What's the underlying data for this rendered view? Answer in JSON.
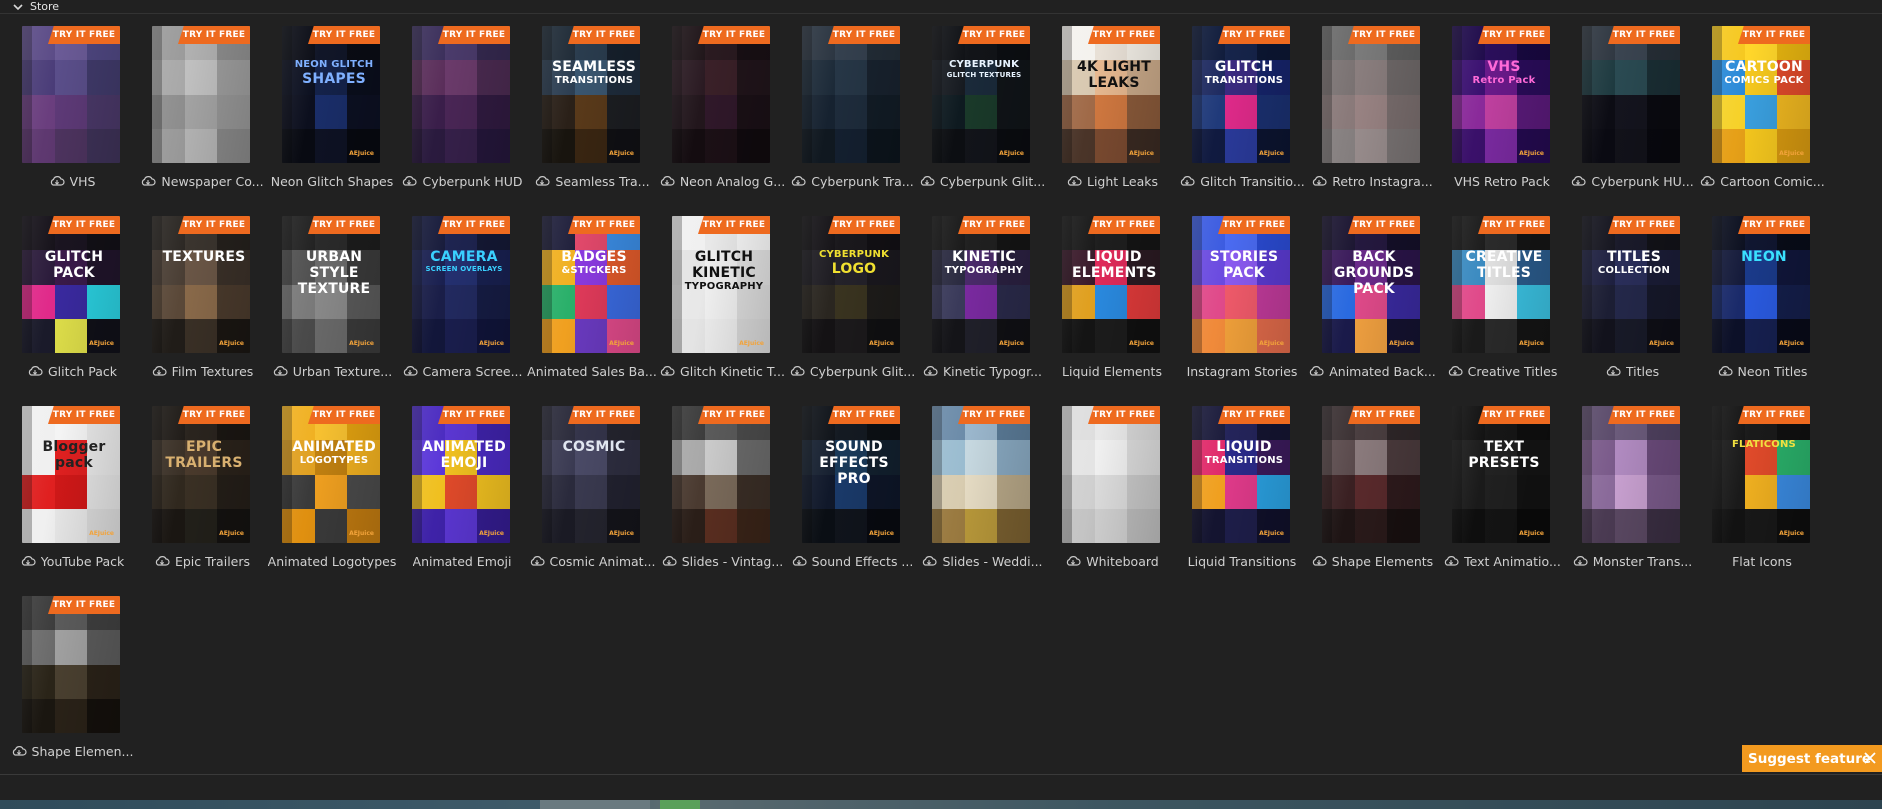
{
  "panel": {
    "title": "Store",
    "chevron_icon": "chevron-down-icon"
  },
  "badge_text": "TRY IT FREE",
  "publisher_mark": "AEJuice",
  "suggest": {
    "label": "Suggest feature",
    "close_icon": "close-icon"
  },
  "items": [
    {
      "label": "VHS",
      "cloud": true,
      "art": [],
      "colors": [
        "#5a4a86",
        "#6a5a96",
        "#4e4680",
        "#4a3c78",
        "#5a4e8a",
        "#403a6a",
        "#6a3e7e",
        "#5e3a78",
        "#4a3868",
        "#5e3870",
        "#4e3460",
        "#3e3258"
      ]
    },
    {
      "label": "Newspaper Co...",
      "cloud": true,
      "art": [],
      "colors": [
        "#9a9a9a",
        "#b0b0b0",
        "#8c8c8c",
        "#a8a8a8",
        "#c0c0c0",
        "#9c9c9c",
        "#8e8e8e",
        "#a4a4a4",
        "#969696",
        "#9a9a9a",
        "#b4b4b4",
        "#888888"
      ]
    },
    {
      "label": "Neon Glitch Shapes",
      "cloud": false,
      "art": [
        "NEON GLITCH",
        "SHAPES"
      ],
      "artColor": "#7fb0ff",
      "colors": [
        "#0b0d16",
        "#111628",
        "#0a0c14",
        "#0c1020",
        "#14224a",
        "#0a0e1c",
        "#0c0f1e",
        "#1a2e6a",
        "#0c1022",
        "#080a12",
        "#0e1224",
        "#070910"
      ]
    },
    {
      "label": "Cyberpunk HUD",
      "cloud": true,
      "art": [],
      "colors": [
        "#3a2e5a",
        "#4a3a6a",
        "#34284e",
        "#5a2e5a",
        "#6a3a6a",
        "#4a2a50",
        "#3a1e4a",
        "#4a2656",
        "#301a40",
        "#2a1a3e",
        "#36204a",
        "#24163a"
      ]
    },
    {
      "label": "Seamless Tra...",
      "cloud": true,
      "art": [
        "SEAMLESS",
        "TRANSITIONS"
      ],
      "artColor": "#ffffff",
      "colors": [
        "#1e2a36",
        "#2a3c4e",
        "#16202c",
        "#2c3e52",
        "#3a5670",
        "#1e2c3c",
        "#2a2018",
        "#5a3a1a",
        "#1c1e22",
        "#18140e",
        "#3a2612",
        "#101014"
      ]
    },
    {
      "label": "Neon Analog G...",
      "cloud": true,
      "art": [],
      "colors": [
        "#1e1418",
        "#2a1a20",
        "#180f14",
        "#2a1a22",
        "#3a2028",
        "#20141a",
        "#22161c",
        "#30182a",
        "#1a1016",
        "#140c10",
        "#1c1016",
        "#100a0e"
      ]
    },
    {
      "label": "Cyberpunk Tra...",
      "cloud": true,
      "art": [],
      "colors": [
        "#2a3440",
        "#34404e",
        "#222c36",
        "#1c2a38",
        "#263646",
        "#18222e",
        "#162230",
        "#1e2c3c",
        "#121c26",
        "#101820",
        "#142030",
        "#0c141c"
      ]
    },
    {
      "label": "Cyberpunk Glit...",
      "cloud": true,
      "art": [
        "CYBERPUNK",
        "GLITCH TEXTURES"
      ],
      "artColor": "#e8f4ff",
      "colors": [
        "#0e1014",
        "#121418",
        "#0c0e12",
        "#161a20",
        "#1a2a3a",
        "#101418",
        "#0e1a20",
        "#1a3a2a",
        "#101418",
        "#0c0e12",
        "#12141a",
        "#0a0c10"
      ]
    },
    {
      "label": "Light Leaks",
      "cloud": true,
      "art": [
        "4K LIGHT",
        "LEAKS"
      ],
      "artColor": "#111111",
      "colors": [
        "#f4f2ee",
        "#e8e0d6",
        "#f0ece4",
        "#d8c8b0",
        "#e6b890",
        "#c8a888",
        "#a06a48",
        "#d07840",
        "#8a5a3a",
        "#4a3428",
        "#7a4a30",
        "#3a2a22"
      ]
    },
    {
      "label": "Glitch Transitio...",
      "cloud": true,
      "art": [
        "GLITCH",
        "TRANSITIONS"
      ],
      "artColor": "#ffffff",
      "colors": [
        "#0e1a3a",
        "#16244a",
        "#0c1632",
        "#1e2a60",
        "#3a2a80",
        "#16246a",
        "#203a7a",
        "#e02a8a",
        "#1a3070",
        "#101a40",
        "#2a3a9a",
        "#0c1430"
      ]
    },
    {
      "label": "Retro Instagra...",
      "cloud": true,
      "art": [],
      "colors": [
        "#6a6a6a",
        "#7a7a7a",
        "#5e5e5e",
        "#7a7272",
        "#8a7e7e",
        "#6e6868",
        "#8a7a7a",
        "#9a8484",
        "#7a6e6e",
        "#868080",
        "#9a8e8e",
        "#7a7474"
      ]
    },
    {
      "label": "VHS Retro Pack",
      "cloud": false,
      "art": [
        "VHS",
        "Retro Pack"
      ],
      "artColor": "#ff6ad8",
      "colors": [
        "#1e0a4a",
        "#2a0e5a",
        "#180840",
        "#3a1070",
        "#6a1a8a",
        "#2a0c5a",
        "#8a2a9a",
        "#c040a0",
        "#5a1a7a",
        "#3a106a",
        "#7a2aa0",
        "#240a50"
      ]
    },
    {
      "label": "Cyberpunk HU...",
      "cloud": true,
      "art": [],
      "colors": [
        "#2e3640",
        "#3a4450",
        "#262e36",
        "#1e3a40",
        "#2a4a52",
        "#1a2e34",
        "#0c0c14",
        "#14141e",
        "#0a0a10",
        "#0a0a12",
        "#12121a",
        "#08080e"
      ]
    },
    {
      "label": "Cartoon Comic...",
      "cloud": true,
      "art": [
        "CARTOON",
        "COMICS PACK"
      ],
      "artColor": "#ffffff",
      "colors": [
        "#f6c81e",
        "#ffd62a",
        "#e6b410",
        "#2a8ad8",
        "#f6c81e",
        "#e04a2a",
        "#f6d22a",
        "#3aa0e0",
        "#f0b820",
        "#e6a018",
        "#f6c81e",
        "#d89a10"
      ]
    },
    {
      "label": "Glitch Pack",
      "cloud": true,
      "art": [
        "GLITCH",
        "PACK"
      ],
      "artColor": "#ffffff",
      "colors": [
        "#141018",
        "#1a1420",
        "#121016",
        "#2a1a3a",
        "#3a1a4a",
        "#20142a",
        "#e02a8a",
        "#3a2aa0",
        "#2ad0e0",
        "#1a1a2a",
        "#e0e04a",
        "#101018"
      ]
    },
    {
      "label": "Film Textures",
      "cloud": true,
      "art": [
        "TEXTURES"
      ],
      "artColor": "#ffffff",
      "colors": [
        "#2a2622",
        "#3a342e",
        "#24201c",
        "#4a3e34",
        "#6a5646",
        "#3a3028",
        "#5a4838",
        "#8a6a4a",
        "#4a3a2c",
        "#201c18",
        "#3a3026",
        "#1a1612"
      ]
    },
    {
      "label": "Urban Texture...",
      "cloud": true,
      "art": [
        "URBAN",
        "STYLE",
        "TEXTURE"
      ],
      "artColor": "#ffffff",
      "colors": [
        "#202020",
        "#2a2a2a",
        "#1c1c1c",
        "#505050",
        "#6a6a6a",
        "#3a3a3a",
        "#7a7a7a",
        "#8a8a8a",
        "#5a5a5a",
        "#4a4a4a",
        "#6a6a6a",
        "#3a3a3a"
      ]
    },
    {
      "label": "Camera Scree...",
      "cloud": true,
      "art": [
        "CAMERA",
        "SCREEN OVERLAYS"
      ],
      "artColor": "#3ad0ff",
      "colors": [
        "#161a3a",
        "#1e2450",
        "#141834",
        "#1a2050",
        "#243070",
        "#182050",
        "#1a1e48",
        "#222a60",
        "#161c44",
        "#12163a",
        "#1a1e4e",
        "#10143a"
      ]
    },
    {
      "label": "Animated Sales Ba...",
      "cloud": false,
      "art": [
        "BADGES",
        "&STICKERS"
      ],
      "artColor": "#ffffff",
      "colors": [
        "#1e1e3a",
        "#e0486a",
        "#3a8ae0",
        "#f0b020",
        "#8a3ae0",
        "#e05a2a",
        "#2ab06a",
        "#e03a5a",
        "#3a6ae0",
        "#f0a020",
        "#6a3ac0",
        "#e04a8a"
      ]
    },
    {
      "label": "Glitch Kinetic T...",
      "cloud": true,
      "art": [
        "GLITCH",
        "KINETIC",
        "TYPOGRAPHY"
      ],
      "artColor": "#111111",
      "colors": [
        "#f0f0f0",
        "#e8e8e8",
        "#f4f4f4",
        "#e4e4e4",
        "#eeeeee",
        "#e0e0e0",
        "#e8e8e8",
        "#f0f0f0",
        "#dcdcdc",
        "#e4e4e4",
        "#ececec",
        "#d8d8d8"
      ]
    },
    {
      "label": "Cyberpunk Glit...",
      "cloud": true,
      "art": [
        "CYBERPUNK",
        "LOGO"
      ],
      "artColor": "#f0e030",
      "colors": [
        "#141216",
        "#1a181c",
        "#121014",
        "#1e1c22",
        "#24222a",
        "#1a181e",
        "#2a2620",
        "#3a3420",
        "#1e1c1a",
        "#141214",
        "#1c1a1c",
        "#101012"
      ]
    },
    {
      "label": "Kinetic Typogr...",
      "cloud": true,
      "art": [
        "KINETIC",
        "TYPOGRAPHY"
      ],
      "artColor": "#ffffff",
      "colors": [
        "#181818",
        "#202020",
        "#141414",
        "#2a2a40",
        "#4a2a6a",
        "#2a2040",
        "#3a3a5a",
        "#7a2aa0",
        "#2a2a4a",
        "#141418",
        "#20202a",
        "#101014"
      ]
    },
    {
      "label": "Liquid Elements",
      "cloud": false,
      "art": [
        "LIQUID",
        "ELEMENTS"
      ],
      "artColor": "#ffffff",
      "colors": [
        "#181818",
        "#1e1e1e",
        "#141414",
        "#3a1a2a",
        "#e02a5a",
        "#2a1a22",
        "#e0a020",
        "#2a8ae0",
        "#e03a3a",
        "#141414",
        "#1c1c1c",
        "#101010"
      ]
    },
    {
      "label": "Instagram Stories",
      "cloud": false,
      "art": [
        "STORIES",
        "PACK"
      ],
      "artColor": "#ffffff",
      "colors": [
        "#3a5ae0",
        "#4a6af0",
        "#2a4ad0",
        "#6a4ae0",
        "#8a5af0",
        "#5a3ad0",
        "#e04a8a",
        "#f05a6a",
        "#c03a9a",
        "#f08a3a",
        "#f0a03a",
        "#e06a4a"
      ]
    },
    {
      "label": "Animated Back...",
      "cloud": true,
      "art": [
        "BACK",
        "GROUNDS",
        "PACK"
      ],
      "artColor": "#ffffff",
      "colors": [
        "#1a1430",
        "#24183e",
        "#140f28",
        "#3a1a5a",
        "#6a2a8a",
        "#2a1448",
        "#2a6ae0",
        "#e04a8a",
        "#3a2aa0",
        "#1a1a4a",
        "#f0a040",
        "#141230"
      ]
    },
    {
      "label": "Creative Titles",
      "cloud": true,
      "art": [
        "CREATIVE",
        "TITLES"
      ],
      "artColor": "#ffffff",
      "colors": [
        "#1a1a1a",
        "#2a2a2a",
        "#141414",
        "#3a8ac0",
        "#e0e0e0",
        "#2a5a8a",
        "#e04a8a",
        "#f0f0f0",
        "#3ac0e0",
        "#1a1a1a",
        "#2a2a2a",
        "#141414"
      ]
    },
    {
      "label": "Titles",
      "cloud": true,
      "art": [
        "TITLES",
        "COLLECTION"
      ],
      "artColor": "#ffffff",
      "colors": [
        "#14141e",
        "#1a1a2a",
        "#121218",
        "#1e2040",
        "#2a2e5a",
        "#1a1c36",
        "#1c1e34",
        "#24284a",
        "#16182a",
        "#12121c",
        "#181a28",
        "#0e0e16"
      ]
    },
    {
      "label": "Neon Titles",
      "cloud": true,
      "art": [
        "NEON"
      ],
      "artColor": "#3ae0ff",
      "colors": [
        "#0a0e1e",
        "#101630",
        "#080c18",
        "#141a3a",
        "#1a3a8a",
        "#10163a",
        "#1a2a6a",
        "#2a5ae0",
        "#141e4a",
        "#0c1028",
        "#162050",
        "#080a18"
      ]
    },
    {
      "label": "YouTube Pack",
      "cloud": true,
      "art": [
        "Blogger",
        "pack"
      ],
      "artColor": "#222222",
      "colors": [
        "#f0f0f0",
        "#f4f4f4",
        "#e8e8e8",
        "#f0f0f0",
        "#e02020",
        "#e8e8e8",
        "#e02020",
        "#d01818",
        "#e4e4e4",
        "#f0f0f0",
        "#e8e8e8",
        "#dcdcdc"
      ]
    },
    {
      "label": "Epic Trailers",
      "cloud": true,
      "art": [
        "EPIC",
        "TRAILERS"
      ],
      "artColor": "#d8b070",
      "colors": [
        "#1e1a16",
        "#2a241e",
        "#1a1612",
        "#3a3026",
        "#4a3a2c",
        "#2a221a",
        "#30281e",
        "#3a3024",
        "#241e18",
        "#1a1612",
        "#22201a",
        "#141210"
      ]
    },
    {
      "label": "Animated Logotypes",
      "cloud": false,
      "art": [
        "ANIMATED",
        "LOGOTYPES"
      ],
      "artColor": "#ffffff",
      "colors": [
        "#f0b020",
        "#f6c030",
        "#e0a010",
        "#e0a020",
        "#c08010",
        "#f0b020",
        "#3a3a3a",
        "#f0a020",
        "#4a4a4a",
        "#e09010",
        "#3a3a3a",
        "#c07a10"
      ]
    },
    {
      "label": "Animated Emoji",
      "cloud": false,
      "art": [
        "ANIMATED",
        "EMOJI"
      ],
      "artColor": "#ffffff",
      "colors": [
        "#4a2ac0",
        "#5a36d0",
        "#3e22a8",
        "#5a36d8",
        "#f0c020",
        "#4a2ac0",
        "#f0c020",
        "#e04a2a",
        "#f0c020",
        "#3e22a8",
        "#5a36d0",
        "#341c90"
      ]
    },
    {
      "label": "Cosmic Animat...",
      "cloud": true,
      "art": [
        "COSMIC"
      ],
      "artColor": "#e0e6f0",
      "colors": [
        "#2a2a3a",
        "#34344a",
        "#24242e",
        "#3a3a52",
        "#4a4a66",
        "#2e2e40",
        "#2a2a3c",
        "#3a3a50",
        "#222230",
        "#1a1a24",
        "#24242e",
        "#14141a"
      ]
    },
    {
      "label": "Slides - Vintag...",
      "cloud": true,
      "art": [],
      "colors": [
        "#3a3a3a",
        "#5a5a5a",
        "#4a4a4a",
        "#a8a8a8",
        "#cacaca",
        "#6a6a6a",
        "#4a3a30",
        "#7a6a5a",
        "#3a2e26",
        "#2a1e18",
        "#5a2e20",
        "#3a2418"
      ]
    },
    {
      "label": "Sound Effects ...",
      "cloud": true,
      "art": [
        "SOUND",
        "EFFECTS",
        "PRO"
      ],
      "artColor": "#ffffff",
      "colors": [
        "#0e1218",
        "#141a22",
        "#0c1014",
        "#162030",
        "#1a3a5a",
        "#12202e",
        "#10182a",
        "#1a3a6a",
        "#0e1628",
        "#0a0e14",
        "#10141c",
        "#080a10"
      ]
    },
    {
      "label": "Slides - Weddi...",
      "cloud": true,
      "art": [],
      "colors": [
        "#6a8aa8",
        "#9ab6cc",
        "#5a7a96",
        "#9abcd0",
        "#c6d8e0",
        "#88a8c0",
        "#d8ccb0",
        "#e6dcc4",
        "#b8a888",
        "#9a7a40",
        "#b8983a",
        "#7a6030"
      ]
    },
    {
      "label": "Whiteboard",
      "cloud": true,
      "art": [],
      "colors": [
        "#dedede",
        "#e8e8e8",
        "#d6d6d6",
        "#e4e4e4",
        "#f0f0f0",
        "#dadada",
        "#d0d0d0",
        "#dcdcdc",
        "#c8c8c8",
        "#c4c4c4",
        "#d0d0d0",
        "#bcbcbc"
      ]
    },
    {
      "label": "Liquid Transitions",
      "cloud": false,
      "art": [
        "LIQUID",
        "TRANSITIONS"
      ],
      "artColor": "#ffffff",
      "colors": [
        "#1a1a3a",
        "#24245a",
        "#141430",
        "#e02a6a",
        "#2a2a8a",
        "#3a1a5a",
        "#f0a020",
        "#e03a8a",
        "#2aa0e0",
        "#141430",
        "#1e1e4a",
        "#10102a"
      ]
    },
    {
      "label": "Shape Elements",
      "cloud": true,
      "art": [],
      "colors": [
        "#3a3032",
        "#4a3e40",
        "#2e2628",
        "#5a4a4c",
        "#8a7a7c",
        "#4a3a3c",
        "#3a2022",
        "#5a2a2c",
        "#2e1a1c",
        "#1e1414",
        "#2a1a1a",
        "#181010"
      ]
    },
    {
      "label": "Text Animatio...",
      "cloud": true,
      "art": [
        "TEXT",
        "PRESETS"
      ],
      "artColor": "#ffffff",
      "colors": [
        "#101010",
        "#161616",
        "#0e0e0e",
        "#1a1a1a",
        "#222222",
        "#141414",
        "#1a1a1a",
        "#202020",
        "#121212",
        "#0e0e0e",
        "#141414",
        "#0a0a0a"
      ]
    },
    {
      "label": "Monster Trans...",
      "cloud": true,
      "art": [],
      "colors": [
        "#5a4a6a",
        "#6a5a7a",
        "#4e405e",
        "#7a5a8a",
        "#b08ac0",
        "#6a4a7a",
        "#8a6a9a",
        "#c8a0d0",
        "#7a5a8a",
        "#4a3a52",
        "#5a4862",
        "#3a2e42"
      ]
    },
    {
      "label": "Flat Icons",
      "cloud": false,
      "art": [
        "FLATICONS"
      ],
      "artColor": "#f0e040",
      "colors": [
        "#141414",
        "#1a1a1a",
        "#101010",
        "#1a1a1a",
        "#e04a2a",
        "#2ab06a",
        "#1a1a1a",
        "#f0b020",
        "#3a8ae0",
        "#121212",
        "#181818",
        "#0e0e0e"
      ]
    },
    {
      "label": "Shape Elemen...",
      "cloud": true,
      "art": [],
      "colors": [
        "#3a3a3a",
        "#5a5a5a",
        "#3e3e3e",
        "#6a6a6a",
        "#a0a0a0",
        "#5a5a5a",
        "#2a2418",
        "#4a4030",
        "#2a2218",
        "#1a1610",
        "#2a2218",
        "#14100c"
      ]
    }
  ]
}
